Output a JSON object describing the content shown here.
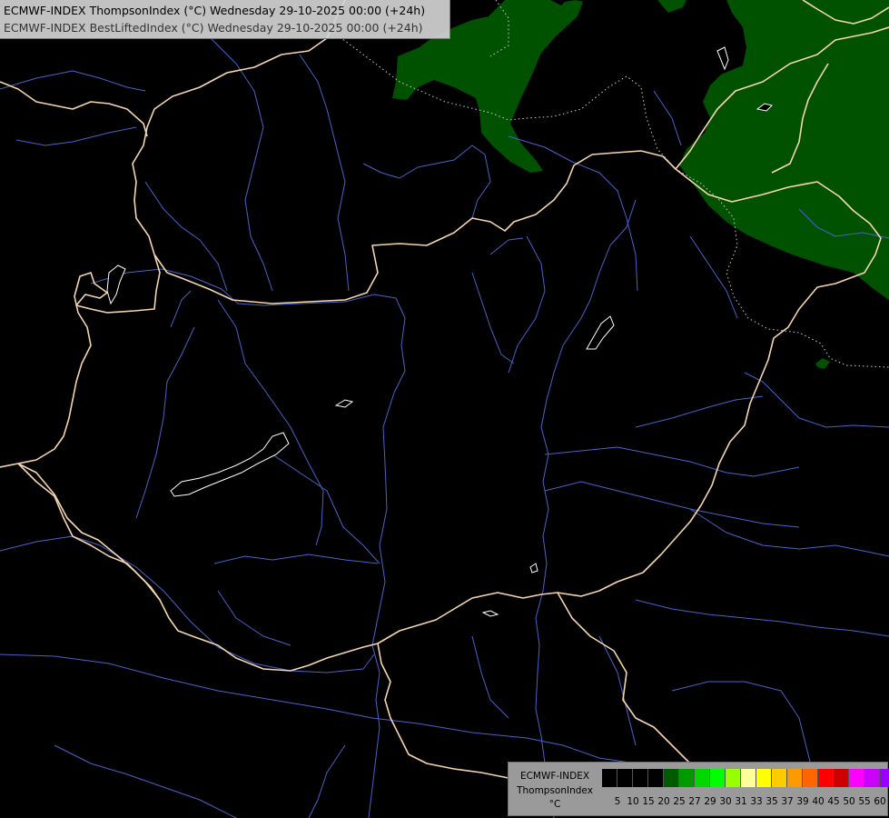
{
  "header": {
    "line1": "ECMWF-INDEX ThompsonIndex (°C) Wednesday 29-10-2025 00:00 (+24h)",
    "line2": "ECMWF-INDEX BestLiftedIndex (°C) Wednesday 29-10-2025 00:00 (+24h)"
  },
  "legend": {
    "model": "ECMWF-INDEX",
    "parameter": "ThompsonIndex",
    "unit": "°C",
    "swatches": [
      {
        "color": "#000000"
      },
      {
        "color": "#000000"
      },
      {
        "color": "#000000"
      },
      {
        "color": "#000000"
      },
      {
        "color": "#005a00"
      },
      {
        "color": "#009900"
      },
      {
        "color": "#00d800"
      },
      {
        "color": "#00ff00"
      },
      {
        "color": "#99ff00"
      },
      {
        "color": "#ffff99"
      },
      {
        "color": "#ffff00"
      },
      {
        "color": "#ffcc00"
      },
      {
        "color": "#ff9900"
      },
      {
        "color": "#ff6600"
      },
      {
        "color": "#ff0000"
      },
      {
        "color": "#cc0000"
      },
      {
        "color": "#ff00ff"
      },
      {
        "color": "#cc00ff"
      },
      {
        "color": "#9900ff"
      },
      {
        "color": "#6600ff"
      },
      {
        "color": "#0000ff"
      }
    ],
    "ticks": [
      "5",
      "10",
      "15",
      "20",
      "25",
      "27",
      "29",
      "30",
      "31",
      "33",
      "35",
      "37",
      "39",
      "40",
      "45",
      "50",
      "55",
      "60"
    ]
  },
  "map_colors": {
    "background": "#000000",
    "border": "#f5d6b0",
    "river": "#4a62c8",
    "lake": "#ffffff",
    "zone": "#005200",
    "dotted": "#cfcfcf"
  }
}
